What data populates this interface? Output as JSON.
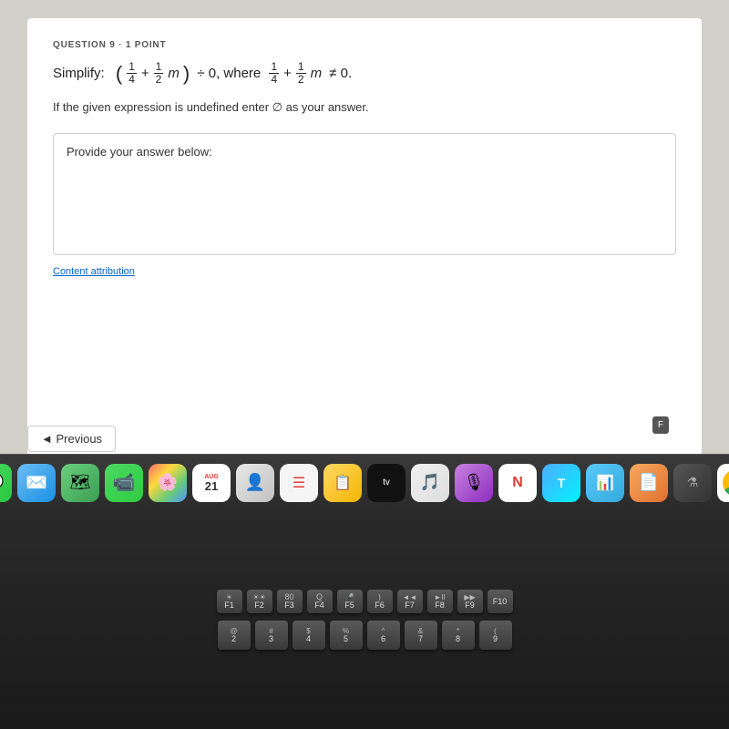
{
  "question": {
    "label": "QUESTION 9  ·  1 POINT",
    "instruction": "Simplify:",
    "math_display": "(1/4 + 1/2·m) ÷ 0, where 1/4 + 1/2·m ≠ 0.",
    "note": "If the given expression is undefined enter ∅ as your answer.",
    "answer_prompt": "Provide your answer below:",
    "content_attribution": "Content attribution",
    "flag_label": "F"
  },
  "nav": {
    "prev_label": "◄ Previous"
  },
  "dock": {
    "apps": [
      {
        "name": "messages",
        "icon": "💬",
        "label": "Messages"
      },
      {
        "name": "mail",
        "icon": "✉️",
        "label": "Mail"
      },
      {
        "name": "maps",
        "icon": "🗺️",
        "label": "Maps"
      },
      {
        "name": "facetime",
        "icon": "📹",
        "label": "FaceTime"
      },
      {
        "name": "photos",
        "icon": "🌅",
        "label": "Photos"
      },
      {
        "name": "calendar",
        "month": "AUG",
        "day": "21",
        "label": "Calendar"
      },
      {
        "name": "contacts",
        "icon": "👤",
        "label": "Contacts"
      },
      {
        "name": "reminders",
        "icon": "☰",
        "label": "Reminders"
      },
      {
        "name": "notes",
        "icon": "📝",
        "label": "Notes"
      },
      {
        "name": "appletv",
        "icon": "tv",
        "label": "Apple TV"
      },
      {
        "name": "music",
        "icon": "🎵",
        "label": "Music"
      },
      {
        "name": "podcasts",
        "icon": "🎙️",
        "label": "Podcasts"
      },
      {
        "name": "news",
        "icon": "N",
        "label": "News"
      },
      {
        "name": "translate",
        "icon": "T",
        "label": "Translate"
      },
      {
        "name": "numbers",
        "icon": "📊",
        "label": "Numbers"
      },
      {
        "name": "pages",
        "icon": "A",
        "label": "Pages"
      },
      {
        "name": "instruments",
        "icon": "⚗️",
        "label": "Instruments"
      },
      {
        "name": "chrome",
        "icon": "chrome",
        "label": "Chrome"
      }
    ]
  },
  "keyboard": {
    "row1": [
      {
        "label": "F1",
        "top": "☀",
        "main": "F1"
      },
      {
        "label": "F2",
        "top": "☀☀",
        "main": "F2"
      },
      {
        "label": "F3",
        "top": "80",
        "main": "F3"
      },
      {
        "label": "F4",
        "top": "Q",
        "main": "F4"
      },
      {
        "label": "F5",
        "top": "🎤",
        "main": "F5"
      },
      {
        "label": "F6",
        "top": ")",
        "main": "F6"
      },
      {
        "label": "F7",
        "top": "◄◄",
        "main": "F7"
      },
      {
        "label": "F8",
        "top": "►II",
        "main": "F8"
      },
      {
        "label": "F9",
        "top": "►►",
        "main": "F9"
      },
      {
        "label": "F10",
        "main": "F10"
      }
    ],
    "row2": [
      {
        "top": "@",
        "main": "2"
      },
      {
        "top": "#",
        "main": "3"
      },
      {
        "top": "$",
        "main": "4"
      },
      {
        "top": "%",
        "main": "5"
      },
      {
        "top": "^",
        "main": "6"
      },
      {
        "top": "&",
        "main": "7"
      },
      {
        "top": "*",
        "main": "8"
      },
      {
        "top": "(",
        "main": "9"
      }
    ]
  }
}
